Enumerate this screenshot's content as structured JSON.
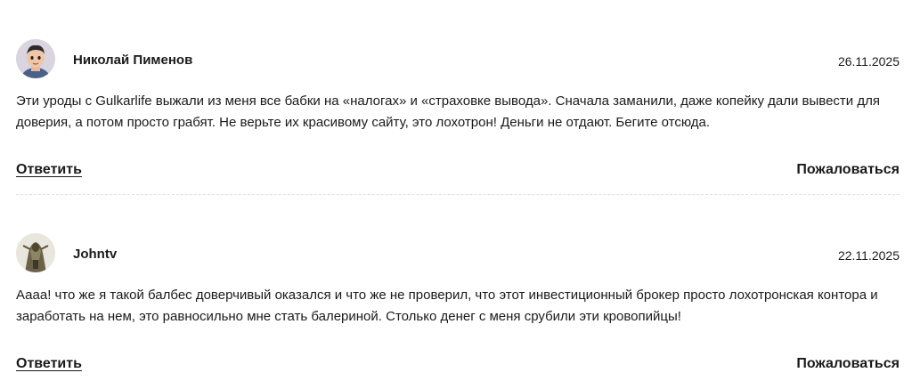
{
  "comments": [
    {
      "author": "Николай Пименов",
      "avatar_icon": "user-avatar-cartoon",
      "date": "26.11.2025",
      "text": "Эти уроды с Gulkarlife выжали из меня все бабки на «налогах» и «страховке вывода». Сначала заманили, даже копейку дали вывести для доверия, а потом просто грабят. Не верьте их красивому сайту, это лохотрон! Деньги не отдают. Бегите отсюда.",
      "reply_label": "Ответить",
      "report_label": "Пожаловаться"
    },
    {
      "author": "Johntv",
      "avatar_icon": "user-avatar-photo",
      "date": "22.11.2025",
      "text": "Аааа! что же я такой балбес доверчивый оказался и что же не проверил, что этот инвестиционный брокер просто лохотронская контора и заработать на нем, это равносильно мне стать балериной. Столько денег с меня срубили эти кровопийцы!",
      "reply_label": "Ответить",
      "report_label": "Пожаловаться"
    }
  ]
}
